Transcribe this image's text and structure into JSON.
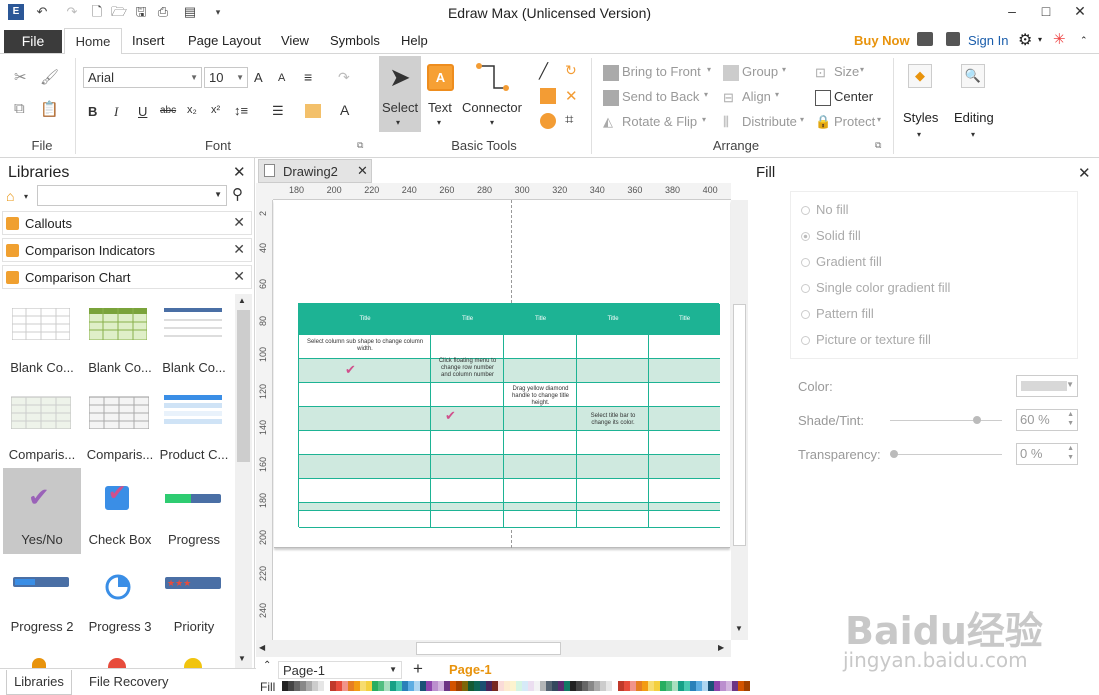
{
  "app": {
    "title": "Edraw Max (Unlicensed Version)"
  },
  "menu": {
    "file": "File",
    "tabs": [
      "Home",
      "Insert",
      "Page Layout",
      "View",
      "Symbols",
      "Help"
    ],
    "buy_now": "Buy Now",
    "sign_in": "Sign In"
  },
  "ribbon": {
    "groups": {
      "file": "File",
      "font": "Font",
      "basic_tools": "Basic Tools",
      "arrange": "Arrange"
    },
    "font_name": "Arial",
    "font_size": "10",
    "tools": {
      "select": "Select",
      "text": "Text",
      "connector": "Connector"
    },
    "arrange": {
      "bring_front": "Bring to Front",
      "send_back": "Send to Back",
      "rotate_flip": "Rotate & Flip",
      "group": "Group",
      "align": "Align",
      "distribute": "Distribute",
      "size": "Size",
      "center": "Center",
      "protect": "Protect"
    },
    "styles": "Styles",
    "editing": "Editing"
  },
  "libraries": {
    "title": "Libraries",
    "sections": [
      "Callouts",
      "Comparison Indicators",
      "Comparison Chart"
    ],
    "shapes": [
      {
        "label": "Blank Co...",
        "icon": "blank-table-icon"
      },
      {
        "label": "Blank Co...",
        "icon": "green-table-icon"
      },
      {
        "label": "Blank Co...",
        "icon": "blue-header-table-icon"
      },
      {
        "label": "Comparis...",
        "icon": "comparison-table-icon"
      },
      {
        "label": "Comparis...",
        "icon": "comparison-grid-icon"
      },
      {
        "label": "Product C...",
        "icon": "product-table-icon"
      },
      {
        "label": "Yes/No",
        "icon": "checkmark-icon"
      },
      {
        "label": "Check Box",
        "icon": "checkbox-icon"
      },
      {
        "label": "Progress",
        "icon": "progress-bar-icon"
      },
      {
        "label": "Progress 2",
        "icon": "progress-bar-2-icon"
      },
      {
        "label": "Progress 3",
        "icon": "progress-ring-icon"
      },
      {
        "label": "Priority",
        "icon": "priority-stars-icon"
      }
    ],
    "bottom_tabs": [
      "Libraries",
      "File Recovery"
    ]
  },
  "canvas": {
    "doc_tab": "Drawing2",
    "ruler_h": [
      "180",
      "200",
      "220",
      "240",
      "260",
      "280",
      "300",
      "320",
      "340",
      "360",
      "380",
      "400"
    ],
    "ruler_v": [
      "2",
      "40",
      "60",
      "80",
      "100",
      "120",
      "140",
      "160",
      "180",
      "200",
      "220",
      "240"
    ],
    "table": {
      "headers": [
        "Title",
        "Title",
        "Title",
        "Title",
        "Title"
      ],
      "notes": [
        "Select column sub shape to change column width.",
        "Click floating menu to change row number and column number",
        "Drag yellow diamond handle to change title height.",
        "Select title bar to change its color."
      ]
    },
    "page_name": "Page-1",
    "page_tab": "Page-1",
    "fill_label": "Fill"
  },
  "fill": {
    "title": "Fill",
    "options": [
      "No fill",
      "Solid fill",
      "Gradient fill",
      "Single color gradient fill",
      "Pattern fill",
      "Picture or texture fill"
    ],
    "selected": "Solid fill",
    "color_label": "Color:",
    "shade_label": "Shade/Tint:",
    "shade_value": "60 %",
    "transparency_label": "Transparency:",
    "transparency_value": "0 %",
    "shade_level": 0.8,
    "transparency_level": 0.0
  },
  "watermark": {
    "text": "Baidu经验",
    "url": "jingyan.baidu.com"
  }
}
